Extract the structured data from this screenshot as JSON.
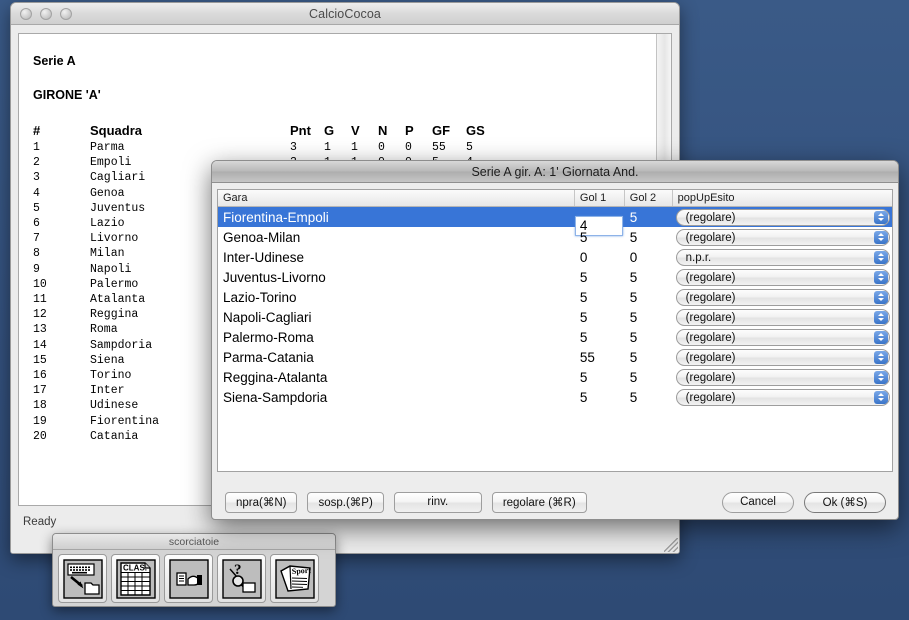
{
  "desktop": {
    "background_color": "#35537f"
  },
  "main_window": {
    "title": "CalcioCocoa",
    "traffic_lights": [
      "close",
      "minimize",
      "zoom"
    ],
    "document": {
      "heading1": "Serie A",
      "heading2": "GIRONE 'A'",
      "standings_headers": [
        "#",
        "Squadra",
        "Pnt",
        "G",
        "V",
        "N",
        "P",
        "GF",
        "GS"
      ],
      "standings_rows": [
        {
          "rank": "1",
          "team": "Parma",
          "pnt": "3",
          "g": "1",
          "v": "1",
          "n": "0",
          "p": "0",
          "gf": "55",
          "gs": "5"
        },
        {
          "rank": "2",
          "team": "Empoli",
          "pnt": "3",
          "g": "1",
          "v": "1",
          "n": "0",
          "p": "0",
          "gf": "5",
          "gs": "4"
        },
        {
          "rank": "3",
          "team": "Cagliari",
          "pnt": "",
          "g": "",
          "v": "",
          "n": "",
          "p": "",
          "gf": "",
          "gs": ""
        },
        {
          "rank": "4",
          "team": "Genoa",
          "pnt": "",
          "g": "",
          "v": "",
          "n": "",
          "p": "",
          "gf": "",
          "gs": ""
        },
        {
          "rank": "5",
          "team": "Juventus",
          "pnt": "",
          "g": "",
          "v": "",
          "n": "",
          "p": "",
          "gf": "",
          "gs": ""
        },
        {
          "rank": "6",
          "team": "Lazio",
          "pnt": "",
          "g": "",
          "v": "",
          "n": "",
          "p": "",
          "gf": "",
          "gs": ""
        },
        {
          "rank": "7",
          "team": "Livorno",
          "pnt": "",
          "g": "",
          "v": "",
          "n": "",
          "p": "",
          "gf": "",
          "gs": ""
        },
        {
          "rank": "8",
          "team": "Milan",
          "pnt": "",
          "g": "",
          "v": "",
          "n": "",
          "p": "",
          "gf": "",
          "gs": ""
        },
        {
          "rank": "9",
          "team": "Napoli",
          "pnt": "",
          "g": "",
          "v": "",
          "n": "",
          "p": "",
          "gf": "",
          "gs": ""
        },
        {
          "rank": "10",
          "team": "Palermo",
          "pnt": "",
          "g": "",
          "v": "",
          "n": "",
          "p": "",
          "gf": "",
          "gs": ""
        },
        {
          "rank": "11",
          "team": "Atalanta",
          "pnt": "",
          "g": "",
          "v": "",
          "n": "",
          "p": "",
          "gf": "",
          "gs": ""
        },
        {
          "rank": "12",
          "team": "Reggina",
          "pnt": "",
          "g": "",
          "v": "",
          "n": "",
          "p": "",
          "gf": "",
          "gs": ""
        },
        {
          "rank": "13",
          "team": "Roma",
          "pnt": "",
          "g": "",
          "v": "",
          "n": "",
          "p": "",
          "gf": "",
          "gs": ""
        },
        {
          "rank": "14",
          "team": "Sampdoria",
          "pnt": "",
          "g": "",
          "v": "",
          "n": "",
          "p": "",
          "gf": "",
          "gs": ""
        },
        {
          "rank": "15",
          "team": "Siena",
          "pnt": "",
          "g": "",
          "v": "",
          "n": "",
          "p": "",
          "gf": "",
          "gs": ""
        },
        {
          "rank": "16",
          "team": "Torino",
          "pnt": "",
          "g": "",
          "v": "",
          "n": "",
          "p": "",
          "gf": "",
          "gs": ""
        },
        {
          "rank": "17",
          "team": "Inter",
          "pnt": "",
          "g": "",
          "v": "",
          "n": "",
          "p": "",
          "gf": "",
          "gs": ""
        },
        {
          "rank": "18",
          "team": "Udinese",
          "pnt": "",
          "g": "",
          "v": "",
          "n": "",
          "p": "",
          "gf": "",
          "gs": ""
        },
        {
          "rank": "19",
          "team": "Fiorentina",
          "pnt": "",
          "g": "",
          "v": "",
          "n": "",
          "p": "",
          "gf": "",
          "gs": ""
        },
        {
          "rank": "20",
          "team": "Catania",
          "pnt": "",
          "g": "",
          "v": "",
          "n": "",
          "p": "",
          "gf": "",
          "gs": ""
        }
      ]
    },
    "status": "Ready"
  },
  "palette": {
    "title": "scorciatoie",
    "buttons": [
      {
        "name": "keyboard-to-folder-icon",
        "label": ""
      },
      {
        "name": "classifica-table-icon",
        "label": "CLAS."
      },
      {
        "name": "document-hand-icon",
        "label": ""
      },
      {
        "name": "question-magnifier-icon",
        "label": "?"
      },
      {
        "name": "sport-newspaper-icon",
        "label": "Sport"
      }
    ]
  },
  "dialog": {
    "title": "Serie A gir. A: 1' Giornata And.",
    "columns": [
      "Gara",
      "Gol 1",
      "Gol 2",
      "popUpEsito"
    ],
    "selected_row_index": 0,
    "editing_cell": {
      "row": 0,
      "column": "Gol 1",
      "value": "4"
    },
    "selection_color": "#3875d7",
    "rows": [
      {
        "gara": "Fiorentina-Empoli",
        "gol1": "4",
        "gol2": "5",
        "esito": "(regolare)"
      },
      {
        "gara": "Genoa-Milan",
        "gol1": "5",
        "gol2": "5",
        "esito": "(regolare)"
      },
      {
        "gara": "Inter-Udinese",
        "gol1": "0",
        "gol2": "0",
        "esito": "n.p.r."
      },
      {
        "gara": "Juventus-Livorno",
        "gol1": "5",
        "gol2": "5",
        "esito": "(regolare)"
      },
      {
        "gara": "Lazio-Torino",
        "gol1": "5",
        "gol2": "5",
        "esito": "(regolare)"
      },
      {
        "gara": "Napoli-Cagliari",
        "gol1": "5",
        "gol2": "5",
        "esito": "(regolare)"
      },
      {
        "gara": "Palermo-Roma",
        "gol1": "5",
        "gol2": "5",
        "esito": "(regolare)"
      },
      {
        "gara": "Parma-Catania",
        "gol1": "55",
        "gol2": "5",
        "esito": "(regolare)"
      },
      {
        "gara": "Reggina-Atalanta",
        "gol1": "5",
        "gol2": "5",
        "esito": "(regolare)"
      },
      {
        "gara": "Siena-Sampdoria",
        "gol1": "5",
        "gol2": "5",
        "esito": "(regolare)"
      }
    ],
    "buttons": {
      "npra": "npra(⌘N)",
      "sosp": "sosp.(⌘P)",
      "rinv": "rinv.",
      "regolare": "regolare (⌘R)",
      "cancel": "Cancel",
      "ok": "Ok (⌘S)"
    }
  }
}
